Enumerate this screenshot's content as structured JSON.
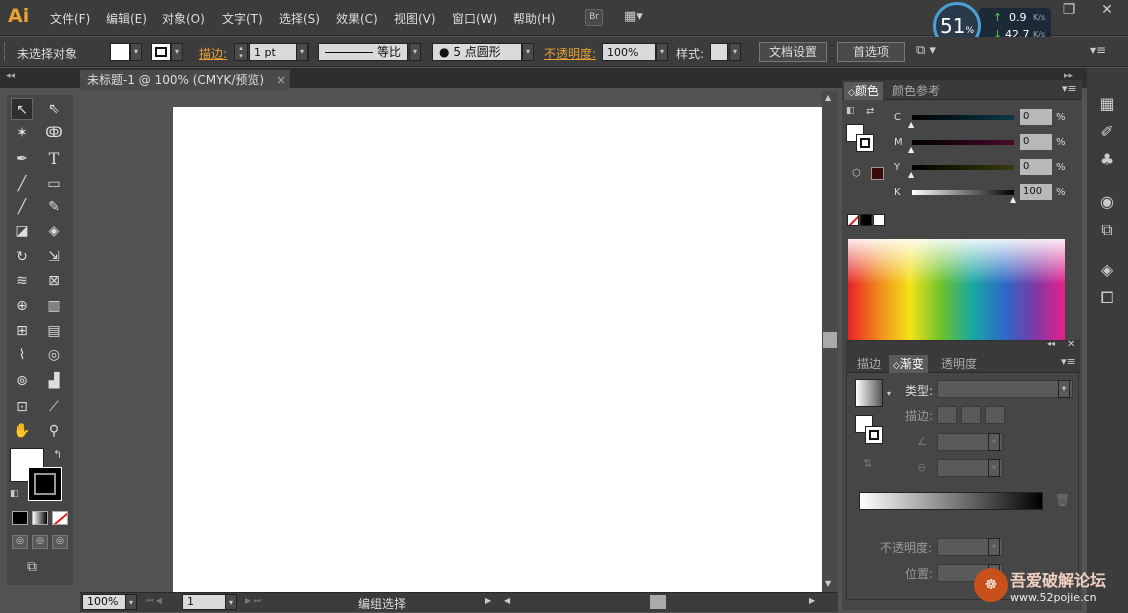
{
  "app": {
    "logo": "Ai"
  },
  "menu": [
    "文件(F)",
    "编辑(E)",
    "对象(O)",
    "文字(T)",
    "选择(S)",
    "效果(C)",
    "视图(V)",
    "窗口(W)",
    "帮助(H)"
  ],
  "menu_bridge_label": "Br",
  "window_controls": {
    "minimize": "—",
    "restore": "❐",
    "close": "✕"
  },
  "net_monitor": {
    "percent": "51",
    "unit": "%",
    "upload": "0.9",
    "download": "42.7",
    "rate_unit": "K/s"
  },
  "control_bar": {
    "selection_label": "未选择对象",
    "stroke_label": "描边:",
    "stroke_value": "1 pt",
    "stroke_profile": "等比",
    "brush_label": "5 点圆形",
    "opacity_label": "不透明度:",
    "opacity_value": "100%",
    "style_label": "样式:",
    "doc_setup_button": "文档设置",
    "preferences_button": "首选项"
  },
  "document_tab": {
    "title": "未标题-1 @ 100% (CMYK/预览)",
    "close": "×"
  },
  "status_bar": {
    "zoom": "100%",
    "page": "1",
    "status_text": "编组选择"
  },
  "color_panel": {
    "tabs": [
      "颜色",
      "颜色参考"
    ],
    "channels": [
      {
        "label": "C",
        "value": "0",
        "unit": "%"
      },
      {
        "label": "M",
        "value": "0",
        "unit": "%"
      },
      {
        "label": "Y",
        "value": "0",
        "unit": "%"
      },
      {
        "label": "K",
        "value": "100",
        "unit": "%"
      }
    ]
  },
  "gradient_panel": {
    "tabs": [
      "描边",
      "渐变",
      "透明度"
    ],
    "type_label": "类型:",
    "stroke_label": "描边:",
    "opacity_label": "不透明度:",
    "location_label": "位置:"
  },
  "watermark": {
    "title": "吾爱破解论坛",
    "url": "www.52pojie.cn"
  },
  "colors": {
    "accent": "#e8a236",
    "canvas": "#ffffff",
    "chrome": "#535353"
  }
}
